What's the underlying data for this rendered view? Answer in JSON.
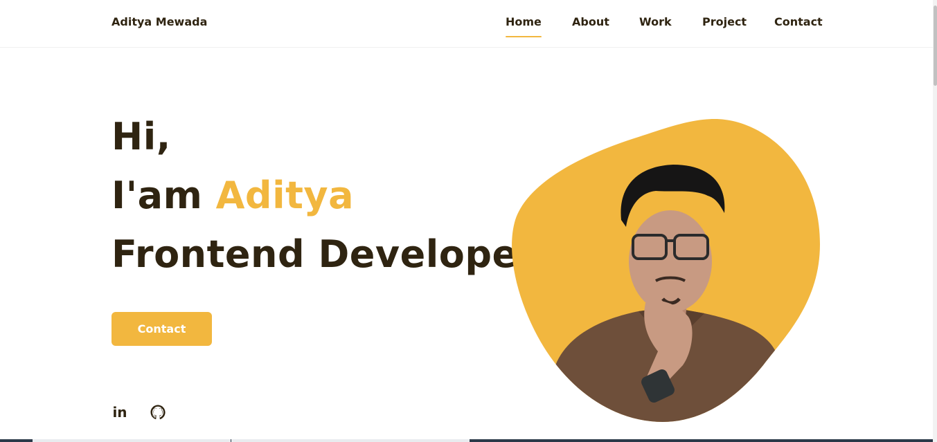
{
  "header": {
    "logo": "Aditya Mewada",
    "nav": [
      {
        "label": "Home",
        "active": true
      },
      {
        "label": "About",
        "active": false
      },
      {
        "label": "Work",
        "active": false
      },
      {
        "label": "Project",
        "active": false
      },
      {
        "label": "Contact",
        "active": false
      }
    ]
  },
  "hero": {
    "greeting": "Hi,",
    "intro_prefix": "I'am ",
    "name": "Aditya",
    "role": "Frontend Developer",
    "contact_label": "Contact",
    "social_icons": [
      "linkedin-icon",
      "github-icon"
    ],
    "linkedin_text": "in"
  },
  "colors": {
    "accent": "#f2b73f",
    "text": "#2f2411",
    "background": "#ffffff"
  }
}
